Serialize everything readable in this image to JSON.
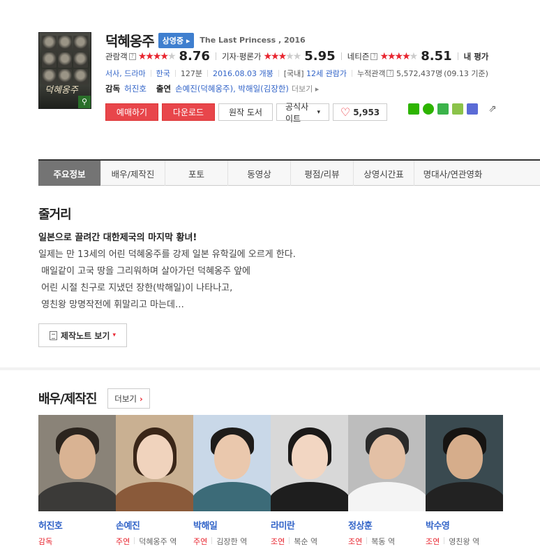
{
  "movie": {
    "title": "덕혜옹주",
    "status_badge": "상영중",
    "badge_arrow": "▸",
    "en_title": "The Last Princess , 2016",
    "poster_title": "덕혜옹주",
    "zoom_icon": "⚲"
  },
  "ratings": {
    "help_glyph": "?",
    "audience": {
      "label": "관람객",
      "score": "8.76",
      "stars_on": "★★★★",
      "stars_off": "★"
    },
    "critic": {
      "label": "기자·평론가",
      "score": "5.95",
      "stars_on": "★★★",
      "stars_off": "★★"
    },
    "netizen": {
      "label": "네티즌",
      "score": "8.51",
      "stars_on": "★★★★",
      "stars_off": "★"
    },
    "my_rating": "내 평가"
  },
  "info": {
    "genre": "서사, 드라마",
    "country": "한국",
    "runtime": "127분",
    "release": "2016.08.03 개봉",
    "rating_prefix": "[국내]",
    "rating": "12세 관람가",
    "cumulative_label": "누적관객",
    "cumulative_value": "5,572,437명",
    "cumulative_date": "(09.13 기준)"
  },
  "credits": {
    "director_label": "감독",
    "director": "허진호",
    "cast_label": "출연",
    "cast_text": "손예진(덕혜옹주), 박해일(김장한)",
    "more": "더보기",
    "more_arrow": "▸"
  },
  "buttons": {
    "reserve": "예매하기",
    "download": "다운로드",
    "original_book": "원작 도서",
    "official_site": "공식사이트",
    "dropdown_caret": "▾",
    "like_count": "5,953",
    "heart": "♡",
    "share": "⇗"
  },
  "sns": [
    "blog-icon",
    "naver-icon",
    "bookmark-star-icon",
    "memo-icon",
    "band-icon"
  ],
  "tabs": [
    "주요정보",
    "배우/제작진",
    "포토",
    "동영상",
    "평점/리뷰",
    "상영시간표",
    "명대사/연관영화"
  ],
  "synopsis": {
    "heading": "줄거리",
    "tagline": "일본으로 끌려간 대한제국의 마지막 황녀!",
    "lines": [
      "일제는 만 13세의 어린 덕혜옹주를 강제 일본 유학길에 오르게 한다.",
      " 매일같이 고국 땅을 그리워하며 살아가던 덕혜옹주 앞에",
      " 어린 시절 친구로 지냈던 장한(박해일)이 나타나고,",
      " 영친왕 망명작전에 휘말리고 마는데…"
    ],
    "note_button": "제작노트 보기",
    "note_caret": "▾"
  },
  "cast_section": {
    "heading": "배우/제작진",
    "more": "더보기",
    "more_arrow": "›",
    "people": [
      {
        "name": "허진호",
        "role": "감독",
        "character": ""
      },
      {
        "name": "손예진",
        "role": "주연",
        "character": "덕혜옹주 역"
      },
      {
        "name": "박해일",
        "role": "주연",
        "character": "김장한 역"
      },
      {
        "name": "라미란",
        "role": "조연",
        "character": "복순 역"
      },
      {
        "name": "정상훈",
        "role": "조연",
        "character": "복동 역"
      },
      {
        "name": "박수영",
        "role": "조연",
        "character": "영친왕 역"
      }
    ]
  },
  "colors": {
    "accent_red": "#e8252f",
    "link_blue": "#3264c8",
    "badge_blue": "#3f7fcf",
    "button_red": "#e8464b"
  }
}
